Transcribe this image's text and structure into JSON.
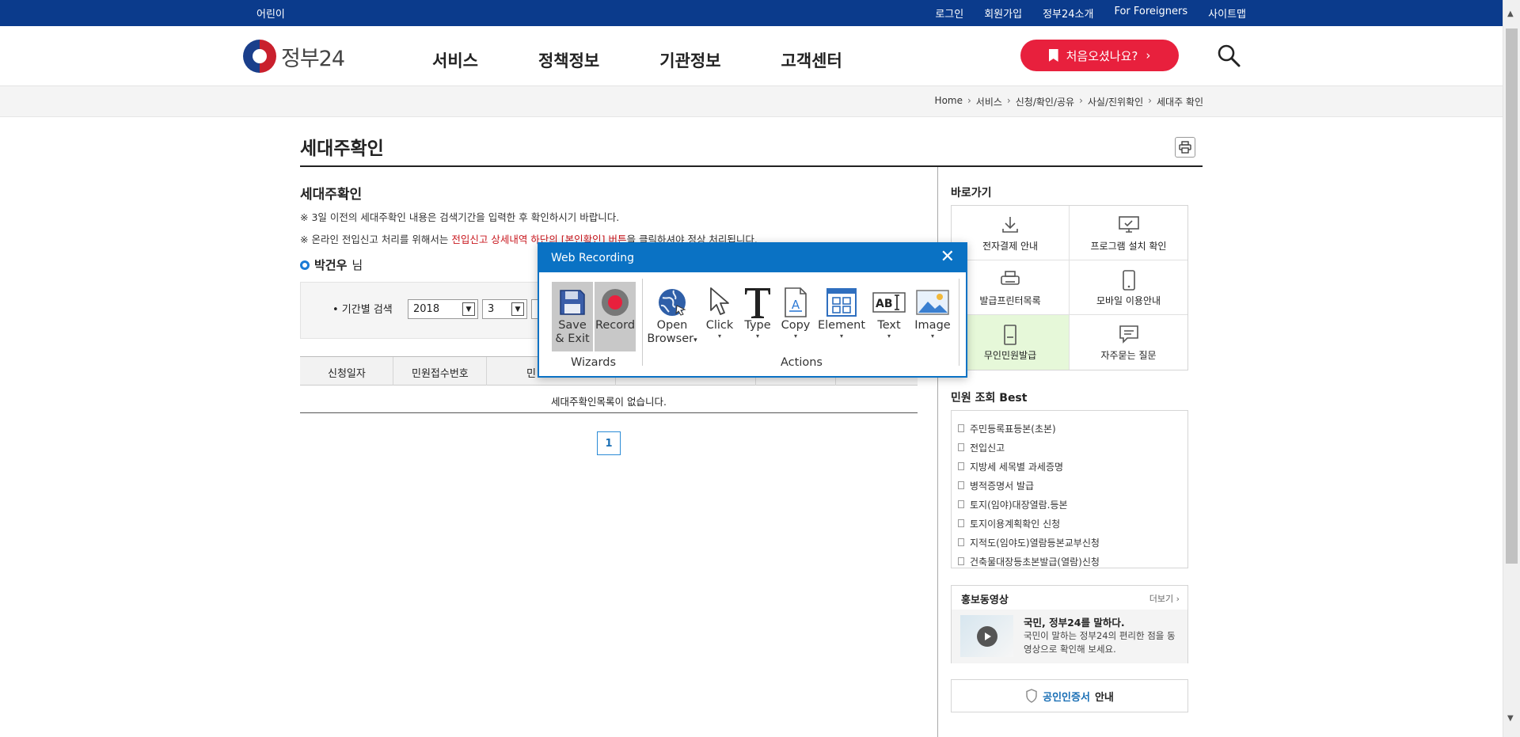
{
  "topbar": {
    "kids": "어린이",
    "links": [
      "로그인",
      "회원가입",
      "정부24소개",
      "For Foreigners",
      "사이트맵"
    ]
  },
  "header": {
    "logo_text": "정부24",
    "nav": [
      "서비스",
      "정책정보",
      "기관정보",
      "고객센터"
    ],
    "first_visit": "처음오셨나요?",
    "first_visit_arrow": "›"
  },
  "breadcrumb": [
    "Home",
    "서비스",
    "신청/확인/공유",
    "사실/진위확인",
    "세대주 확인"
  ],
  "breadcrumb_sep": "›",
  "main": {
    "page_title": "세대주확인",
    "section_title": "세대주확인",
    "notice1": "※ 3일 이전의 세대주확인 내용은 검색기간을 입력한 후 확인하시기 바랍니다.",
    "notice2_prefix": "※ 온라인 전입신고 처리를 위해서는 ",
    "notice2_red": "전입신고 상세내역 하단의 [본인확인] 버튼",
    "notice2_suffix": "을 클릭하셔야 정상 처리됩니다.",
    "user_name": "박건우",
    "user_suffix": "님",
    "search_label": "• 기간별 검색",
    "year": "2018",
    "month": "3",
    "table_headers": [
      "신청일자",
      "민원접수번호",
      "민"
    ],
    "empty_text": "세대주확인목록이 없습니다.",
    "page": "1"
  },
  "sidebar": {
    "quick_title": "바로가기",
    "quick": [
      {
        "label": "전자결제 안내",
        "icon": "download-icon"
      },
      {
        "label": "프로그램 설치 확인",
        "icon": "monitor-icon"
      },
      {
        "label": "발급프린터목록",
        "icon": "printer-icon"
      },
      {
        "label": "모바일 이용안내",
        "icon": "mobile-icon"
      },
      {
        "label": "무인민원발급",
        "icon": "kiosk-icon"
      },
      {
        "label": "자주묻는 질문",
        "icon": "chat-icon"
      }
    ],
    "best_title": "민원 조회 Best",
    "best": [
      "주민등록표등본(초본)",
      "전입신고",
      "지방세 세목별 과세증명",
      "병적증명서 발급",
      "토지(임야)대장열람.등본",
      "토지이용계획확인 신청",
      "지적도(임야도)열람등본교부신청",
      "건축물대장등초본발급(열람)신청"
    ],
    "promo_title": "홍보동영상",
    "promo_more": "더보기 ›",
    "promo_headline": "국민, 정부24를 말하다.",
    "promo_text": "국민이 말하는 정부24의 편리한 점을 동영상으로 확인해 보세요.",
    "cert_blue": "공인인증서",
    "cert_rest": "안내"
  },
  "dialog": {
    "title": "Web Recording",
    "close": "✕",
    "wizards_label": "Wizards",
    "actions_label": "Actions",
    "save_line1": "Save",
    "save_line2": "& Exit",
    "record": "Record",
    "open_line1": "Open",
    "open_line2": "Browser",
    "click": "Click",
    "type": "Type",
    "copy": "Copy",
    "element": "Element",
    "text": "Text",
    "image": "Image",
    "dropdown_glyph": "▾"
  },
  "colors": {
    "topbar": "#0b3b8c",
    "accent_red": "#e8203d",
    "dialog_blue": "#0a72c4",
    "active_quick": "#e6f8d9"
  }
}
